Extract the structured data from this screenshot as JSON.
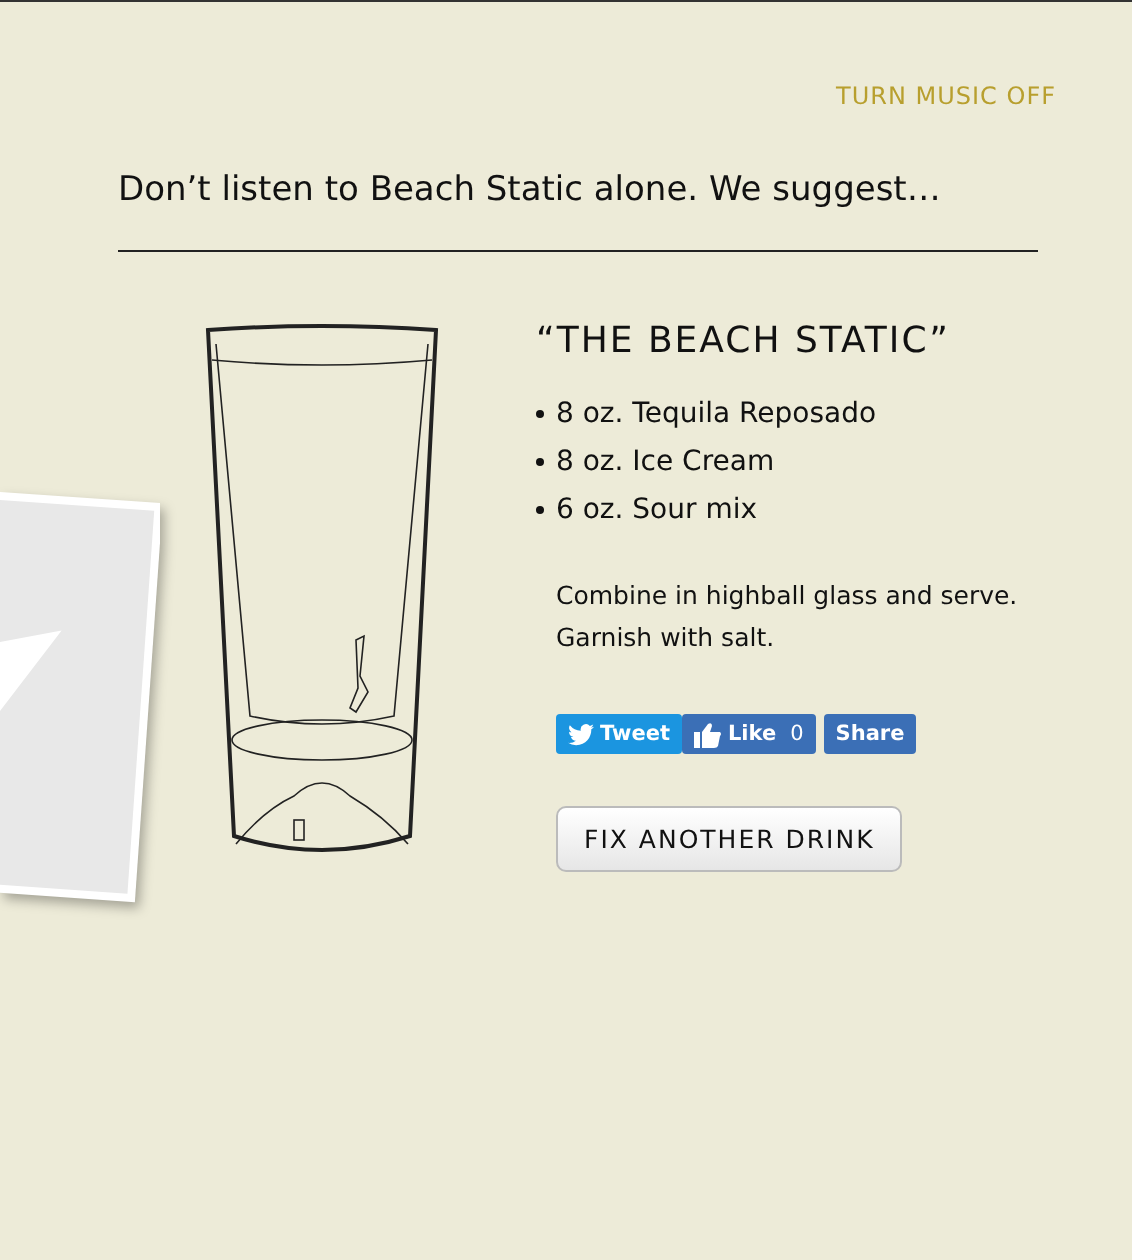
{
  "music_toggle": "TURN MUSIC OFF",
  "heading": "Don’t listen to Beach Static alone. We suggest…",
  "drink": {
    "title": "“THE BEACH STATIC”",
    "ingredients": [
      "8 oz. Tequila Reposado",
      "8 oz. Ice Cream",
      "6 oz. Sour mix"
    ],
    "instructions": "Combine in highball glass and serve. Garnish with salt."
  },
  "share_buttons": [
    {
      "kind": "tweet",
      "label": "Tweet"
    },
    {
      "kind": "like",
      "label": "Like",
      "count": "0"
    },
    {
      "kind": "share",
      "label": "Share"
    }
  ],
  "action_button": "FIX ANOTHER DRINK"
}
